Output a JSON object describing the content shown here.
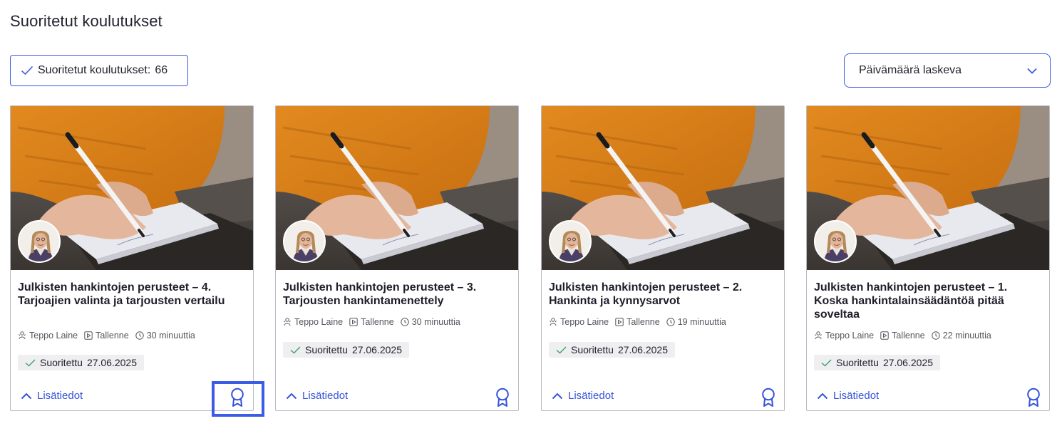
{
  "page": {
    "title": "Suoritetut koulutukset"
  },
  "filter": {
    "label": "Suoritetut koulutukset:",
    "count": "66"
  },
  "sort": {
    "selected": "Päivämäärä laskeva"
  },
  "colors": {
    "accent": "#3d5adf",
    "badge_bg": "#efeff1",
    "check_green": "#3aa36b"
  },
  "cards": [
    {
      "title": "Julkisten hankintojen perusteet – 4. Tarjoajien valinta ja tarjousten vertailu",
      "trainer": "Teppo Laine",
      "format": "Tallenne",
      "duration": "30 minuuttia",
      "status": "Suoritettu",
      "date": "27.06.2025",
      "more": "Lisätiedot",
      "icons": [
        "trainer-icon",
        "play-icon",
        "clock-icon",
        "award-icon"
      ]
    },
    {
      "title": "Julkisten hankintojen perusteet – 3. Tarjousten hankintamenettely",
      "trainer": "Teppo Laine",
      "format": "Tallenne",
      "duration": "30 minuuttia",
      "status": "Suoritettu",
      "date": "27.06.2025",
      "more": "Lisätiedot",
      "icons": [
        "trainer-icon",
        "play-icon",
        "clock-icon",
        "award-icon"
      ]
    },
    {
      "title": "Julkisten hankintojen perusteet – 2. Hankinta ja kynnysarvot",
      "trainer": "Teppo Laine",
      "format": "Tallenne",
      "duration": "19 minuuttia",
      "status": "Suoritettu",
      "date": "27.06.2025",
      "more": "Lisätiedot",
      "icons": [
        "trainer-icon",
        "play-icon",
        "clock-icon",
        "award-icon"
      ]
    },
    {
      "title": "Julkisten hankintojen perusteet – 1. Koska hankintalainsäädäntöä pitää soveltaa",
      "trainer": "Teppo Laine",
      "format": "Tallenne",
      "duration": "22 minuuttia",
      "status": "Suoritettu",
      "date": "27.06.2025",
      "more": "Lisätiedot",
      "icons": [
        "trainer-icon",
        "play-icon",
        "clock-icon",
        "award-icon"
      ]
    }
  ]
}
